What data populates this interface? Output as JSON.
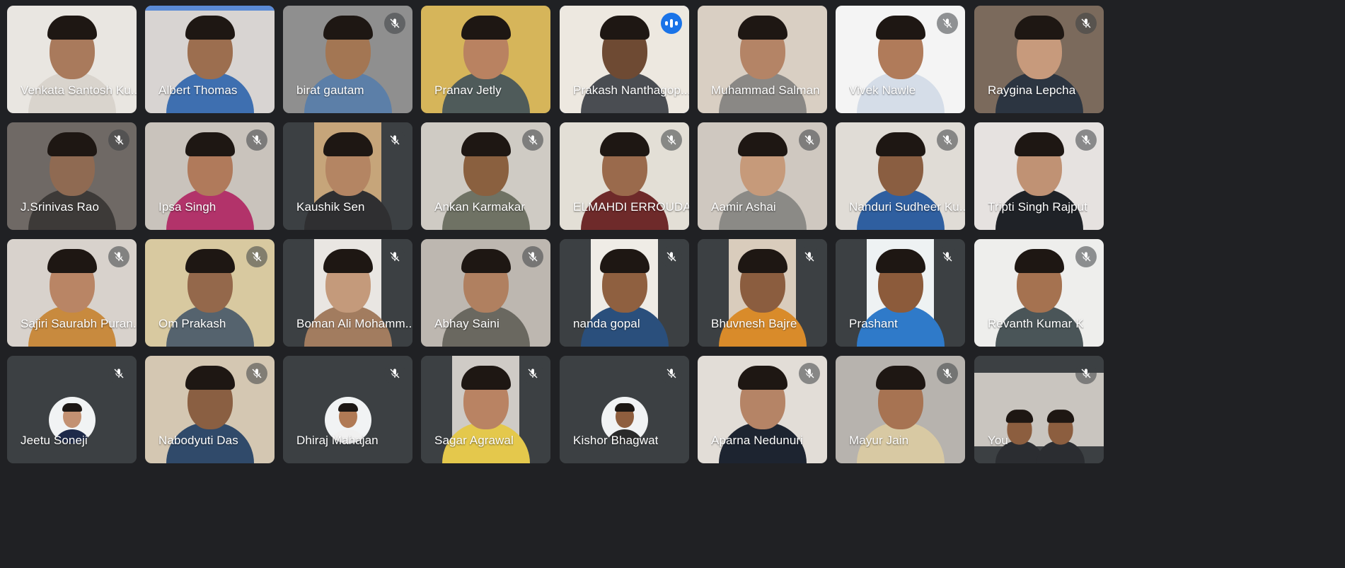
{
  "meeting": {
    "participants": [
      {
        "name": "Venkata Santosh Ku...",
        "muted": false,
        "speaking": false,
        "bg": "#e9e6e1",
        "accent": "",
        "skin": "#a97a5c",
        "shirt": "#d9d4cd"
      },
      {
        "name": "Albert Thomas",
        "muted": false,
        "speaking": false,
        "bg": "#d8d4d2",
        "accent": "#5b8bd6",
        "skin": "#9c6e4f",
        "shirt": "#3e6fb0"
      },
      {
        "name": "birat gautam",
        "muted": true,
        "speaking": false,
        "bg": "#8f8f8f",
        "accent": "",
        "skin": "#a37653",
        "shirt": "#5c7fa8"
      },
      {
        "name": "Pranav Jetly",
        "muted": false,
        "speaking": false,
        "bg": "#d6b55a",
        "accent": "",
        "skin": "#b98261",
        "shirt": "#4f5b5a"
      },
      {
        "name": "Prakash Nanthagop...",
        "muted": false,
        "speaking": true,
        "bg": "#ede8e0",
        "accent": "",
        "skin": "#6e4a33",
        "shirt": "#4a4d52"
      },
      {
        "name": "Muhammad Salman",
        "muted": false,
        "speaking": false,
        "bg": "#d9cfc3",
        "accent": "",
        "skin": "#b48466",
        "shirt": "#8a8885"
      },
      {
        "name": "Vivek Nawle",
        "muted": true,
        "speaking": false,
        "bg": "#f4f4f4",
        "accent": "",
        "skin": "#b07b5a",
        "shirt": "#d5dde8"
      },
      {
        "name": "Raygina Lepcha",
        "muted": true,
        "speaking": false,
        "bg": "#7b6a5c",
        "accent": "",
        "skin": "#c79a7c",
        "shirt": "#2c3541"
      },
      {
        "name": "J.Srinivas Rao",
        "muted": true,
        "speaking": false,
        "bg": "#6f6965",
        "accent": "",
        "skin": "#8f6a52",
        "shirt": "#3d3a38"
      },
      {
        "name": "Ipsa Singh",
        "muted": true,
        "speaking": false,
        "bg": "#c9c3bc",
        "accent": "",
        "skin": "#b07a5b",
        "shirt": "#b2336a"
      },
      {
        "name": "Kaushik Sen",
        "muted": true,
        "speaking": false,
        "bg": "#3c4043",
        "accent": "#c6a57a",
        "skin": "#b48563",
        "shirt": "#2f2f31"
      },
      {
        "name": "Ankan Karmakar",
        "muted": true,
        "speaking": false,
        "bg": "#cfcbc4",
        "accent": "",
        "skin": "#8a603f",
        "shirt": "#6f7264"
      },
      {
        "name": "ELMAHDI ERROUDA...",
        "muted": true,
        "speaking": false,
        "bg": "#e3dfd6",
        "accent": "",
        "skin": "#9a6a4c",
        "shirt": "#6e2a2a"
      },
      {
        "name": "Aamir Ashai",
        "muted": true,
        "speaking": false,
        "bg": "#cfc8c0",
        "accent": "",
        "skin": "#c69a7a",
        "shirt": "#8b8a86"
      },
      {
        "name": "Nanduri Sudheer Ku...",
        "muted": true,
        "speaking": false,
        "bg": "#e0dcd6",
        "accent": "",
        "skin": "#8a5e41",
        "shirt": "#2f5fa0"
      },
      {
        "name": "Tripti Singh Rajput",
        "muted": true,
        "speaking": false,
        "bg": "#e6e2e0",
        "accent": "",
        "skin": "#c09274",
        "shirt": "#1f2227"
      },
      {
        "name": "Sajiri Saurabh Puran...",
        "muted": true,
        "speaking": false,
        "bg": "#d8d2cc",
        "accent": "",
        "skin": "#b98565",
        "shirt": "#c88a3e"
      },
      {
        "name": "Om Prakash",
        "muted": true,
        "speaking": false,
        "bg": "#d8c9a0",
        "accent": "",
        "skin": "#94684b",
        "shirt": "#55636e"
      },
      {
        "name": "Boman Ali Mohamm...",
        "muted": true,
        "speaking": false,
        "bg": "#3c4043",
        "accent": "#e9e6e2",
        "skin": "#c49a7b",
        "shirt": "#a27c5f"
      },
      {
        "name": "Abhay Saini",
        "muted": true,
        "speaking": false,
        "bg": "#bdb7b0",
        "accent": "",
        "skin": "#b08060",
        "shirt": "#6a6860"
      },
      {
        "name": "nanda gopal",
        "muted": true,
        "speaking": false,
        "bg": "#3c4043",
        "accent": "#efece6",
        "skin": "#8f6040",
        "shirt": "#2a4f7c"
      },
      {
        "name": "Bhuvnesh Bajre",
        "muted": true,
        "speaking": false,
        "bg": "#3c4043",
        "accent": "#d9ccbc",
        "skin": "#8b5d3f",
        "shirt": "#d98b2a"
      },
      {
        "name": "Prashant",
        "muted": true,
        "speaking": false,
        "bg": "#3c4043",
        "accent": "#eef2f3",
        "skin": "#8c5b3b",
        "shirt": "#2f7ac9"
      },
      {
        "name": "Revanth Kumar K",
        "muted": true,
        "speaking": false,
        "bg": "#eeeeec",
        "accent": "",
        "skin": "#a57250",
        "shirt": "#4a5558"
      },
      {
        "name": "Jeetu Soneji",
        "muted": true,
        "speaking": false,
        "bg": "#3c4043",
        "accent": "",
        "avatar": true,
        "skin": "#c39172",
        "shirt": "#1e2a4a"
      },
      {
        "name": "Nabodyuti Das",
        "muted": true,
        "speaking": false,
        "bg": "#d4c7b2",
        "accent": "",
        "skin": "#8a5f42",
        "shirt": "#304a6a"
      },
      {
        "name": "Dhiraj Mahajan",
        "muted": true,
        "speaking": false,
        "bg": "#3c4043",
        "accent": "",
        "avatar": true,
        "skin": "#b07a55",
        "shirt": "#f0f0f0"
      },
      {
        "name": "Sagar Agrawal",
        "muted": true,
        "speaking": false,
        "bg": "#3c4043",
        "accent": "#cfcbc6",
        "skin": "#b98363",
        "shirt": "#e4c84c"
      },
      {
        "name": "Kishor Bhagwat",
        "muted": true,
        "speaking": false,
        "bg": "#3c4043",
        "accent": "",
        "avatar": true,
        "skin": "#8e5e3e",
        "shirt": "#2a2a2a"
      },
      {
        "name": "Aparna Nedunuri",
        "muted": true,
        "speaking": false,
        "bg": "#e2ddd7",
        "accent": "",
        "skin": "#b58466",
        "shirt": "#1d2430"
      },
      {
        "name": "Mayur Jain",
        "muted": true,
        "speaking": false,
        "bg": "#b7b3ae",
        "accent": "",
        "skin": "#a77352",
        "shirt": "#d8c9a3"
      },
      {
        "name": "You",
        "muted": true,
        "speaking": false,
        "bg": "#3c4043",
        "accent": "#c9c5bf",
        "skin": "#8c5e3f",
        "shirt": "#2b2d31",
        "pair": true
      }
    ]
  }
}
